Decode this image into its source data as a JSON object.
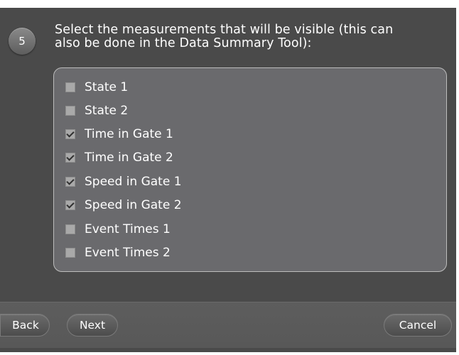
{
  "step": {
    "number": "5",
    "instruction_line1": "Select the measurements that will be visible (this can",
    "instruction_line2": "also be done in the Data Summary Tool):"
  },
  "measurements": [
    {
      "label": "State 1",
      "checked": false
    },
    {
      "label": "State 2",
      "checked": false
    },
    {
      "label": "Time in Gate 1",
      "checked": true
    },
    {
      "label": "Time in Gate 2",
      "checked": true
    },
    {
      "label": "Speed in Gate 1",
      "checked": true
    },
    {
      "label": "Speed in Gate 2",
      "checked": true
    },
    {
      "label": "Event Times 1",
      "checked": false
    },
    {
      "label": "Event Times 2",
      "checked": false
    }
  ],
  "buttons": {
    "back": "Back",
    "next": "Next",
    "cancel": "Cancel"
  },
  "colors": {
    "background": "#4a4a4a",
    "list_background": "#6a6a6d",
    "text": "#ffffff"
  }
}
